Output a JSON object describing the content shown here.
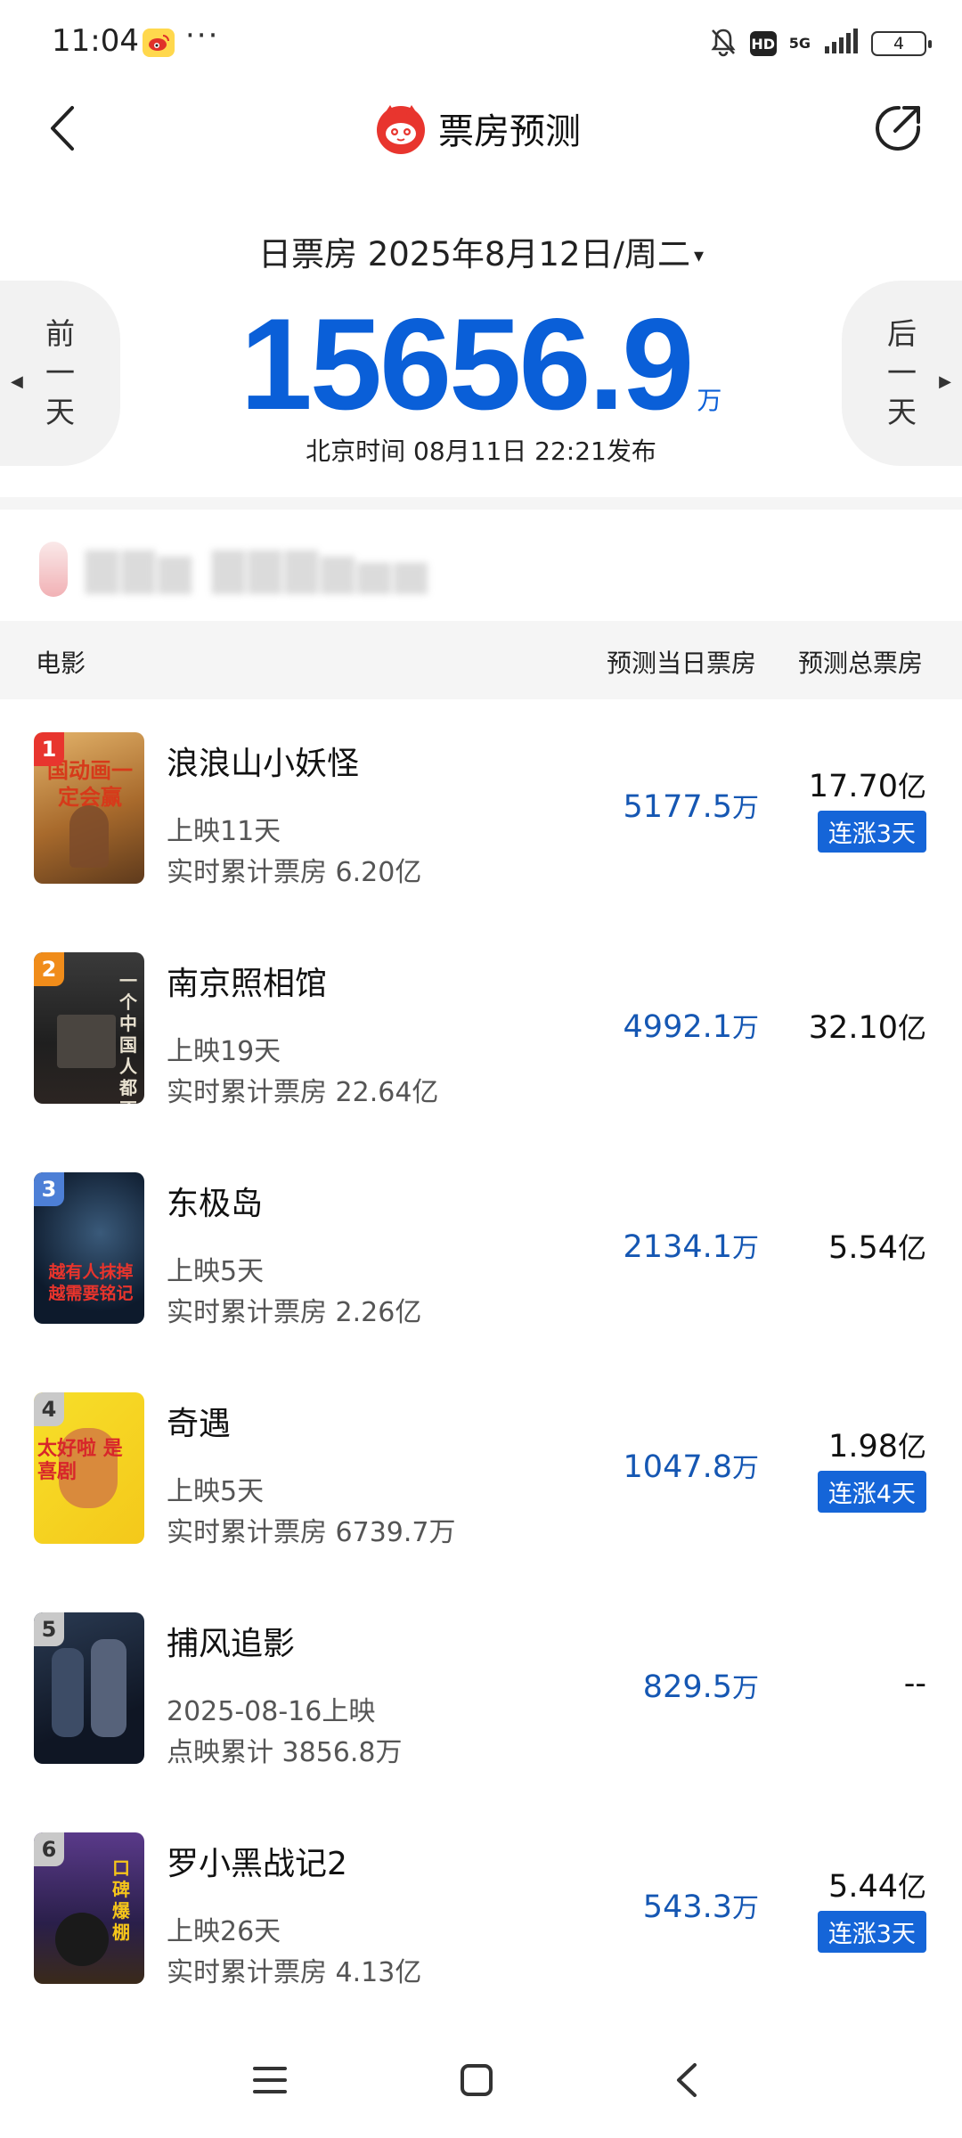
{
  "status_bar": {
    "time": "11:04",
    "dots": "···",
    "network": "5G",
    "hd": "HD",
    "battery": "4",
    "icons": [
      "weibo-icon",
      "mute-bell-icon",
      "hd-icon",
      "signal-icon",
      "battery-icon"
    ]
  },
  "header": {
    "title": "票房预测",
    "back_icon": "chevron-left-icon",
    "share_icon": "share-icon",
    "brand_icon": "maoyan-cat-logo"
  },
  "summary": {
    "date_label": "日票房 2025年8月12日/周二",
    "caret": "▾",
    "total_value": "15656.9",
    "total_unit": "万",
    "publish_time": "北京时间 08月11日 22:21发布",
    "prev_day": [
      "前",
      "一",
      "天"
    ],
    "next_day": [
      "后",
      "一",
      "天"
    ]
  },
  "table_header": {
    "movie": "电影",
    "day_forecast": "预测当日票房",
    "total_forecast": "预测总票房"
  },
  "colors": {
    "accent_blue": "#0a5fd8",
    "value_blue": "#1557b3",
    "streak_bg": "#1565d8",
    "rank1": "#e8352e",
    "rank2": "#f08c1a",
    "rank3": "#4d7fd6",
    "rank_other": "#c9c9c9"
  },
  "movies": [
    {
      "rank": "1",
      "name": "浪浪山小妖怪",
      "days": "上映11天",
      "cumulative": "实时累计票房 6.20亿",
      "day_value": "5177.5",
      "day_unit": "万",
      "total_value": "17.70",
      "total_unit": "亿",
      "streak": "连涨3天",
      "poster_text": "国动画一定会赢"
    },
    {
      "rank": "2",
      "name": "南京照相馆",
      "days": "上映19天",
      "cumulative": "实时累计票房 22.64亿",
      "day_value": "4992.1",
      "day_unit": "万",
      "total_value": "32.10",
      "total_unit": "亿",
      "streak": "",
      "poster_text": "一个中国人 都不会忘记"
    },
    {
      "rank": "3",
      "name": "东极岛",
      "days": "上映5天",
      "cumulative": "实时累计票房 2.26亿",
      "day_value": "2134.1",
      "day_unit": "万",
      "total_value": "5.54",
      "total_unit": "亿",
      "streak": "",
      "poster_text": "越有人抹掉 越需要铭记"
    },
    {
      "rank": "4",
      "name": "奇遇",
      "days": "上映5天",
      "cumulative": "实时累计票房 6739.7万",
      "day_value": "1047.8",
      "day_unit": "万",
      "total_value": "1.98",
      "total_unit": "亿",
      "streak": "连涨4天",
      "poster_text": "太好啦 是喜剧"
    },
    {
      "rank": "5",
      "name": "捕风追影",
      "days": "2025-08-16上映",
      "cumulative": "点映累计 3856.8万",
      "day_value": "829.5",
      "day_unit": "万",
      "total_value": "--",
      "total_unit": "",
      "streak": "",
      "poster_text": ""
    },
    {
      "rank": "6",
      "name": "罗小黑战记2",
      "days": "上映26天",
      "cumulative": "实时累计票房 4.13亿",
      "day_value": "543.3",
      "day_unit": "万",
      "total_value": "5.44",
      "total_unit": "亿",
      "streak": "连涨3天",
      "poster_text": "口碑爆棚"
    }
  ],
  "bottom_nav": {
    "icons": [
      "menu-icon",
      "home-square-icon",
      "back-icon"
    ]
  }
}
